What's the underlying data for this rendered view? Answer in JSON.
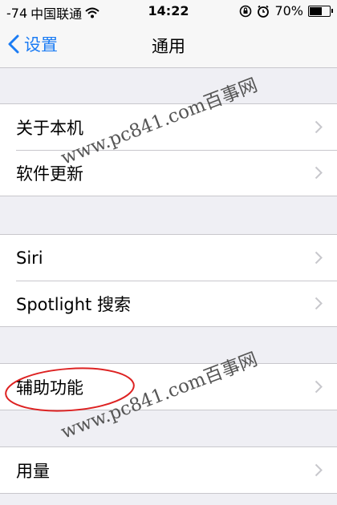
{
  "status": {
    "signal": "-74",
    "carrier": "中国联通",
    "time": "14:22",
    "battery_percent": "70%",
    "battery_level": 0.7,
    "icons": [
      "wifi-icon",
      "rotation-lock-icon",
      "alarm-icon",
      "battery-icon"
    ]
  },
  "nav": {
    "back_label": "设置",
    "title": "通用",
    "accent_color": "#1b7cf4"
  },
  "groups": [
    {
      "items": [
        {
          "label": "关于本机"
        },
        {
          "label": "软件更新"
        }
      ]
    },
    {
      "items": [
        {
          "label": "Siri"
        },
        {
          "label": "Spotlight 搜索"
        }
      ]
    },
    {
      "items": [
        {
          "label": "辅助功能"
        }
      ]
    },
    {
      "items": [
        {
          "label": "用量"
        }
      ]
    }
  ],
  "watermark": "www.pc841.com百事网"
}
